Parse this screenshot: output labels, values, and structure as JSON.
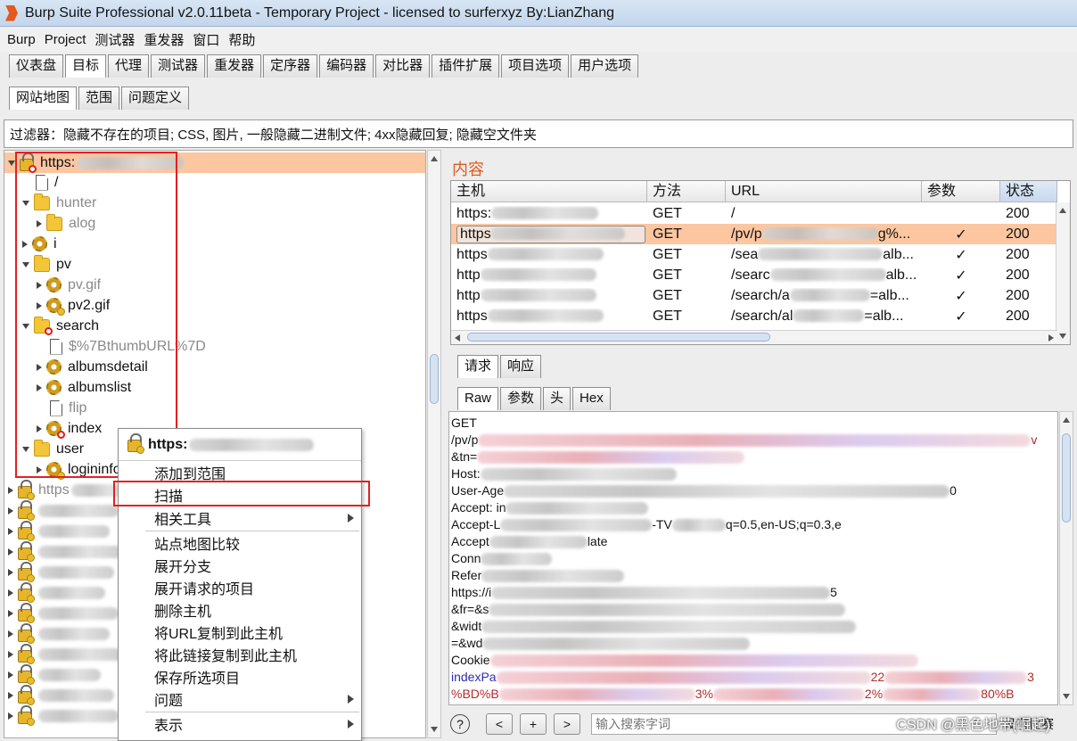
{
  "window": {
    "title": "Burp Suite Professional v2.0.11beta - Temporary Project - licensed to surferxyz By:LianZhang"
  },
  "menu": [
    "Burp",
    "Project",
    "测试器",
    "重发器",
    "窗口",
    "帮助"
  ],
  "main_tabs": [
    "仪表盘",
    "目标",
    "代理",
    "测试器",
    "重发器",
    "定序器",
    "编码器",
    "对比器",
    "插件扩展",
    "项目选项",
    "用户选项"
  ],
  "sub_tabs": [
    "网站地图",
    "范围",
    "问题定义"
  ],
  "filter": "过滤器：隐藏不存在的项目; CSS, 图片, 一般隐藏二进制文件; 4xx隐藏回复; 隐藏空文件夹",
  "tree": {
    "root": "https:",
    "items": [
      {
        "label": "/"
      },
      {
        "label": "hunter"
      },
      {
        "label": "alog"
      },
      {
        "label": "i"
      },
      {
        "label": "pv"
      },
      {
        "label": "pv.gif"
      },
      {
        "label": "pv2.gif"
      },
      {
        "label": "search"
      },
      {
        "label": "$%7BthumbURL%7D"
      },
      {
        "label": "albumsdetail"
      },
      {
        "label": "albumslist"
      },
      {
        "label": "flip"
      },
      {
        "label": "index"
      },
      {
        "label": "user"
      },
      {
        "label": "logininfo"
      }
    ],
    "other_host": "https"
  },
  "context_menu": {
    "header": "https:",
    "items": [
      "添加到范围",
      "扫描",
      "相关工具",
      "站点地图比较",
      "展开分支",
      "展开请求的项目",
      "删除主机",
      "将URL复制到此主机",
      "将此链接复制到此主机",
      "保存所选项目",
      "问题",
      "表示"
    ]
  },
  "content": {
    "heading": "内容",
    "columns": [
      "主机",
      "方法",
      "URL",
      "参数",
      "状态"
    ],
    "rows": [
      {
        "host": "https:",
        "method": "GET",
        "url": "/",
        "params": "",
        "status": "200"
      },
      {
        "host": "https",
        "method": "GET",
        "url": "/pv/p",
        "url_tail": "g%...",
        "params": "✓",
        "status": "200"
      },
      {
        "host": "https",
        "method": "GET",
        "url": "/sea",
        "url_tail": "alb...",
        "params": "✓",
        "status": "200"
      },
      {
        "host": "http",
        "method": "GET",
        "url": "/searc",
        "url_tail": "alb...",
        "params": "✓",
        "status": "200"
      },
      {
        "host": "http",
        "method": "GET",
        "url": "/search/a",
        "url_tail": "=alb...",
        "params": "✓",
        "status": "200"
      },
      {
        "host": "https",
        "method": "GET",
        "url": "/search/al",
        "url_tail": "=alb...",
        "params": "✓",
        "status": "200"
      }
    ]
  },
  "request_tabs": [
    "请求",
    "响应"
  ],
  "format_tabs": [
    "Raw",
    "参数",
    "头",
    "Hex"
  ],
  "raw": {
    "method": "GET",
    "path": "/pv/p",
    "path_tail": "v",
    "tn": "&tn=",
    "host": "Host: ",
    "ua": "User-Age",
    "ua_tail": "0",
    "accept": "Accept: in",
    "accept_lang": "Accept-L",
    "accept_lang_mid": "-TV",
    "accept_lang_tail": "q=0.5,en-US;q=0.3,e",
    "accept_enc": "Accept",
    "accept_enc_tail": "late",
    "conn": "Conn",
    "refer": "Refer",
    "https": "https://i",
    "https_tail": "5",
    "fr": "&fr=&s",
    "widt": "&widt",
    "wd": "=&wd",
    "cookie": "Cookie",
    "index": "indexPa",
    "index_mid": "22",
    "index_tail": "3",
    "bd": "%BD%B",
    "bd_mid": "3%",
    "bd_mid2": "2%",
    "bd_tail": "80%B"
  },
  "search": {
    "placeholder": "输入搜索字词",
    "prev": "<",
    "add": "+",
    "next": ">",
    "help": "?",
    "no_match": "没有比赛"
  },
  "watermark": "CSDN @黑色地带(崛起)"
}
